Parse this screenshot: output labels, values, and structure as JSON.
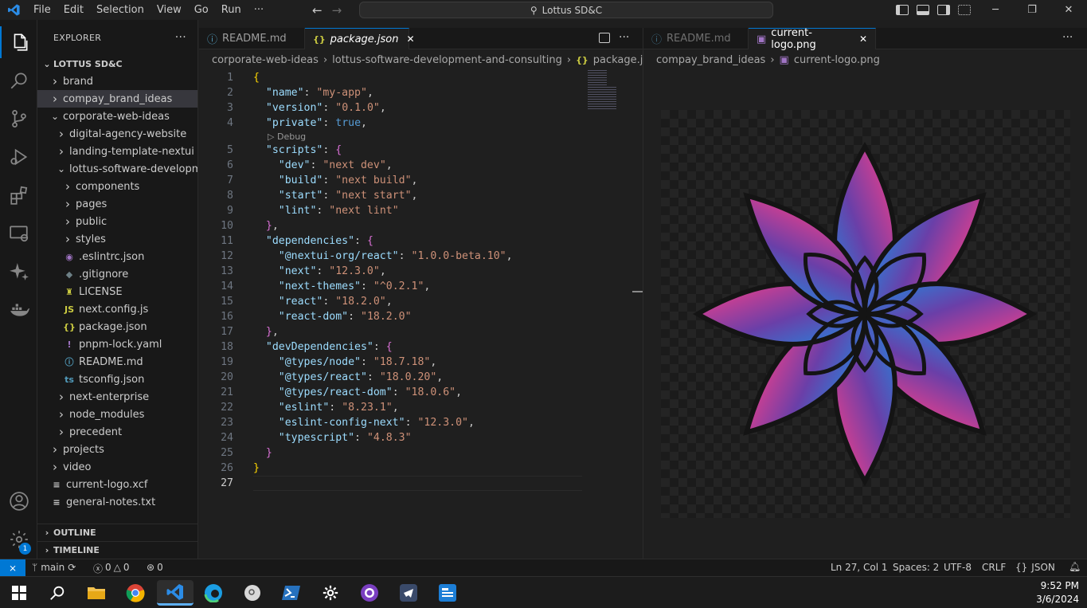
{
  "titlebar": {
    "menu": [
      "File",
      "Edit",
      "Selection",
      "View",
      "Go",
      "Run",
      "···"
    ],
    "search_text": "Lottus SD&C"
  },
  "explorer": {
    "header": "EXPLORER",
    "more": "···",
    "root": "LOTTUS SD&C",
    "items": [
      {
        "label": "brand",
        "type": "folder",
        "open": false,
        "depth": 0
      },
      {
        "label": "compay_brand_ideas",
        "type": "folder",
        "open": false,
        "depth": 0,
        "selected": true
      },
      {
        "label": "corporate-web-ideas",
        "type": "folder",
        "open": true,
        "depth": 0
      },
      {
        "label": "digital-agency-website",
        "type": "folder",
        "open": false,
        "depth": 1
      },
      {
        "label": "landing-template-nextui",
        "type": "folder",
        "open": false,
        "depth": 1
      },
      {
        "label": "lottus-software-developm...",
        "type": "folder",
        "open": true,
        "depth": 1
      },
      {
        "label": "components",
        "type": "folder",
        "open": false,
        "depth": 2
      },
      {
        "label": "pages",
        "type": "folder",
        "open": false,
        "depth": 2
      },
      {
        "label": "public",
        "type": "folder",
        "open": false,
        "depth": 2
      },
      {
        "label": "styles",
        "type": "folder",
        "open": false,
        "depth": 2
      },
      {
        "label": ".eslintrc.json",
        "type": "file",
        "icon": "eslint-icon",
        "glyph": "◉",
        "color": "#a074c4",
        "depth": 2
      },
      {
        "label": ".gitignore",
        "type": "file",
        "icon": "git-icon",
        "glyph": "◆",
        "color": "#6d8086",
        "depth": 2
      },
      {
        "label": "LICENSE",
        "type": "file",
        "icon": "license-icon",
        "glyph": "♜",
        "color": "#cbcb41",
        "depth": 2
      },
      {
        "label": "next.config.js",
        "type": "file",
        "icon": "js-icon",
        "glyph": "JS",
        "color": "#cbcb41",
        "depth": 2
      },
      {
        "label": "package.json",
        "type": "file",
        "icon": "json-icon",
        "glyph": "{}",
        "color": "#cbcb41",
        "depth": 2
      },
      {
        "label": "pnpm-lock.yaml",
        "type": "file",
        "icon": "yaml-icon",
        "glyph": "!",
        "color": "#a074c4",
        "depth": 2
      },
      {
        "label": "README.md",
        "type": "file",
        "icon": "info-icon",
        "glyph": "ⓘ",
        "color": "#519aba",
        "depth": 2
      },
      {
        "label": "tsconfig.json",
        "type": "file",
        "icon": "ts-icon",
        "glyph": "ts",
        "color": "#519aba",
        "depth": 2
      },
      {
        "label": "next-enterprise",
        "type": "folder",
        "open": false,
        "depth": 1
      },
      {
        "label": "node_modules",
        "type": "folder",
        "open": false,
        "depth": 1
      },
      {
        "label": "precedent",
        "type": "folder",
        "open": false,
        "depth": 1
      },
      {
        "label": "projects",
        "type": "folder",
        "open": false,
        "depth": 0
      },
      {
        "label": "video",
        "type": "folder",
        "open": false,
        "depth": 0
      },
      {
        "label": "current-logo.xcf",
        "type": "file",
        "icon": "lines-icon",
        "glyph": "≡",
        "color": "#cccccc",
        "depth": 0
      },
      {
        "label": "general-notes.txt",
        "type": "file",
        "icon": "lines-icon",
        "glyph": "≡",
        "color": "#cccccc",
        "depth": 0
      }
    ],
    "outline": "OUTLINE",
    "timeline": "TIMELINE"
  },
  "editor_left": {
    "tabs": [
      {
        "label": "README.md",
        "icon": "ⓘ",
        "active": false
      },
      {
        "label": "package.json",
        "icon": "{}",
        "active": true,
        "close": "✕"
      }
    ],
    "breadcrumb": [
      "corporate-web-ideas",
      "lottus-software-development-and-consulting",
      "package.json",
      "..."
    ],
    "codelens": "Debug",
    "lines": [
      [
        [
          "b",
          "{"
        ]
      ],
      [
        [
          "c",
          "  "
        ],
        [
          "k",
          "\"name\""
        ],
        [
          "c",
          ": "
        ],
        [
          "s",
          "\"my-app\""
        ],
        [
          "c",
          ","
        ]
      ],
      [
        [
          "c",
          "  "
        ],
        [
          "k",
          "\"version\""
        ],
        [
          "c",
          ": "
        ],
        [
          "s",
          "\"0.1.0\""
        ],
        [
          "c",
          ","
        ]
      ],
      [
        [
          "c",
          "  "
        ],
        [
          "k",
          "\"private\""
        ],
        [
          "c",
          ": "
        ],
        [
          "t",
          "true"
        ],
        [
          "c",
          ","
        ]
      ],
      [
        [
          "c",
          "  "
        ],
        [
          "k",
          "\"scripts\""
        ],
        [
          "c",
          ": "
        ],
        [
          "p",
          "{"
        ]
      ],
      [
        [
          "c",
          "    "
        ],
        [
          "k",
          "\"dev\""
        ],
        [
          "c",
          ": "
        ],
        [
          "s",
          "\"next dev\""
        ],
        [
          "c",
          ","
        ]
      ],
      [
        [
          "c",
          "    "
        ],
        [
          "k",
          "\"build\""
        ],
        [
          "c",
          ": "
        ],
        [
          "s",
          "\"next build\""
        ],
        [
          "c",
          ","
        ]
      ],
      [
        [
          "c",
          "    "
        ],
        [
          "k",
          "\"start\""
        ],
        [
          "c",
          ": "
        ],
        [
          "s",
          "\"next start\""
        ],
        [
          "c",
          ","
        ]
      ],
      [
        [
          "c",
          "    "
        ],
        [
          "k",
          "\"lint\""
        ],
        [
          "c",
          ": "
        ],
        [
          "s",
          "\"next lint\""
        ]
      ],
      [
        [
          "c",
          "  "
        ],
        [
          "p",
          "}"
        ],
        [
          "c",
          ","
        ]
      ],
      [
        [
          "c",
          "  "
        ],
        [
          "k",
          "\"dependencies\""
        ],
        [
          "c",
          ": "
        ],
        [
          "p",
          "{"
        ]
      ],
      [
        [
          "c",
          "    "
        ],
        [
          "k",
          "\"@nextui-org/react\""
        ],
        [
          "c",
          ": "
        ],
        [
          "s",
          "\"1.0.0-beta.10\""
        ],
        [
          "c",
          ","
        ]
      ],
      [
        [
          "c",
          "    "
        ],
        [
          "k",
          "\"next\""
        ],
        [
          "c",
          ": "
        ],
        [
          "s",
          "\"12.3.0\""
        ],
        [
          "c",
          ","
        ]
      ],
      [
        [
          "c",
          "    "
        ],
        [
          "k",
          "\"next-themes\""
        ],
        [
          "c",
          ": "
        ],
        [
          "s",
          "\"^0.2.1\""
        ],
        [
          "c",
          ","
        ]
      ],
      [
        [
          "c",
          "    "
        ],
        [
          "k",
          "\"react\""
        ],
        [
          "c",
          ": "
        ],
        [
          "s",
          "\"18.2.0\""
        ],
        [
          "c",
          ","
        ]
      ],
      [
        [
          "c",
          "    "
        ],
        [
          "k",
          "\"react-dom\""
        ],
        [
          "c",
          ": "
        ],
        [
          "s",
          "\"18.2.0\""
        ]
      ],
      [
        [
          "c",
          "  "
        ],
        [
          "p",
          "}"
        ],
        [
          "c",
          ","
        ]
      ],
      [
        [
          "c",
          "  "
        ],
        [
          "k",
          "\"devDependencies\""
        ],
        [
          "c",
          ": "
        ],
        [
          "p",
          "{"
        ]
      ],
      [
        [
          "c",
          "    "
        ],
        [
          "k",
          "\"@types/node\""
        ],
        [
          "c",
          ": "
        ],
        [
          "s",
          "\"18.7.18\""
        ],
        [
          "c",
          ","
        ]
      ],
      [
        [
          "c",
          "    "
        ],
        [
          "k",
          "\"@types/react\""
        ],
        [
          "c",
          ": "
        ],
        [
          "s",
          "\"18.0.20\""
        ],
        [
          "c",
          ","
        ]
      ],
      [
        [
          "c",
          "    "
        ],
        [
          "k",
          "\"@types/react-dom\""
        ],
        [
          "c",
          ": "
        ],
        [
          "s",
          "\"18.0.6\""
        ],
        [
          "c",
          ","
        ]
      ],
      [
        [
          "c",
          "    "
        ],
        [
          "k",
          "\"eslint\""
        ],
        [
          "c",
          ": "
        ],
        [
          "s",
          "\"8.23.1\""
        ],
        [
          "c",
          ","
        ]
      ],
      [
        [
          "c",
          "    "
        ],
        [
          "k",
          "\"eslint-config-next\""
        ],
        [
          "c",
          ": "
        ],
        [
          "s",
          "\"12.3.0\""
        ],
        [
          "c",
          ","
        ]
      ],
      [
        [
          "c",
          "    "
        ],
        [
          "k",
          "\"typescript\""
        ],
        [
          "c",
          ": "
        ],
        [
          "s",
          "\"4.8.3\""
        ]
      ],
      [
        [
          "c",
          "  "
        ],
        [
          "p",
          "}"
        ]
      ],
      [
        [
          "b",
          "}"
        ]
      ],
      []
    ]
  },
  "editor_right": {
    "tabs": [
      {
        "label": "README.md",
        "icon": "ⓘ",
        "active": false
      },
      {
        "label": "current-logo.png",
        "icon": "▣",
        "active": true,
        "close": "✕"
      }
    ],
    "breadcrumb": [
      "compay_brand_ideas",
      "current-logo.png"
    ],
    "more": "···"
  },
  "statusbar": {
    "branch": "main",
    "errors": "0",
    "warnings": "0",
    "ports": "0",
    "position": "Ln 27, Col 1",
    "spaces": "Spaces: 2",
    "encoding": "UTF-8",
    "eol": "CRLF",
    "language": "JSON",
    "accounts_badge": "1"
  },
  "taskbar": {
    "time": "9:52 PM",
    "date": "3/6/2024"
  }
}
